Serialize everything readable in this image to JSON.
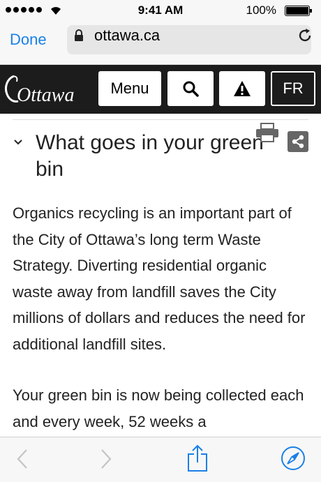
{
  "status": {
    "time": "9:41 AM",
    "battery": "100%"
  },
  "browser": {
    "done_label": "Done",
    "url": "ottawa.ca"
  },
  "site": {
    "logo_text": "Ottawa",
    "menu_label": "Menu",
    "lang_label": "FR"
  },
  "article": {
    "heading": "What goes in your green bin",
    "paragraph1": "Organics recycling is an important part of the City of Ottawa’s long term Waste Strategy. Diverting residential organic waste away from landfill saves the City millions of dollars and reduces the need for additional landfill sites.",
    "paragraph2": "Your green bin is now being collected each and every week, 52 weeks a"
  },
  "colors": {
    "accent": "#1a80e8",
    "header_bg": "#1c1c1c"
  },
  "icons": [
    "wifi-icon",
    "battery-icon",
    "lock-icon",
    "reload-icon",
    "search-icon",
    "alert-icon",
    "chevron-down-icon",
    "printer-icon",
    "share-icon",
    "back-icon",
    "forward-icon",
    "share-up-icon",
    "compass-icon"
  ]
}
